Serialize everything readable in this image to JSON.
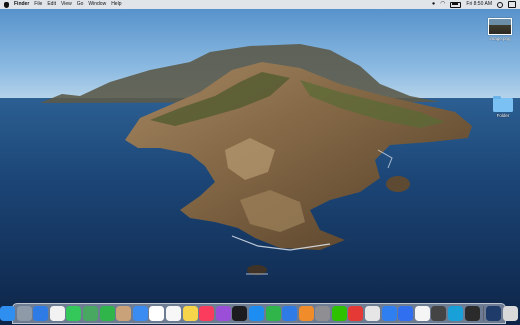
{
  "menubar": {
    "app_name": "Finder",
    "menus": [
      "File",
      "Edit",
      "View",
      "Go",
      "Window",
      "Help"
    ],
    "clock": "Fri 8:50 AM",
    "status_icons": [
      "siri-icon",
      "wifi-icon",
      "battery-icon",
      "search-icon",
      "control-center-icon"
    ]
  },
  "desktop": {
    "wallpaper": "macOS Catalina island",
    "icons": [
      {
        "name": "screenshot-file",
        "label": "image.png",
        "kind": "image"
      },
      {
        "name": "folder",
        "label": "Folder",
        "kind": "folder"
      }
    ]
  },
  "dock": {
    "apps": [
      {
        "name": "finder",
        "color": "#2f8ff0"
      },
      {
        "name": "launchpad",
        "color": "#8f9aa8"
      },
      {
        "name": "safari",
        "color": "#2e7be6"
      },
      {
        "name": "photos",
        "color": "#f2f2f2"
      },
      {
        "name": "messages",
        "color": "#34c759"
      },
      {
        "name": "maps",
        "color": "#48a862"
      },
      {
        "name": "facetime",
        "color": "#2fb54a"
      },
      {
        "name": "contacts",
        "color": "#c9a27a"
      },
      {
        "name": "mail",
        "color": "#3b8cf2"
      },
      {
        "name": "calendar",
        "color": "#ffffff"
      },
      {
        "name": "reminders",
        "color": "#f7f7f7"
      },
      {
        "name": "notes",
        "color": "#f7d54a"
      },
      {
        "name": "music",
        "color": "#fb3c5c"
      },
      {
        "name": "podcasts",
        "color": "#9b4fd8"
      },
      {
        "name": "apple-tv",
        "color": "#1c1c1e"
      },
      {
        "name": "app-store",
        "color": "#1d8df2"
      },
      {
        "name": "numbers",
        "color": "#2fb54a"
      },
      {
        "name": "keynote",
        "color": "#2e7be6"
      },
      {
        "name": "pages",
        "color": "#f08c2a"
      },
      {
        "name": "system-preferences",
        "color": "#8e8e93"
      },
      {
        "name": "wechat",
        "color": "#2dc100"
      },
      {
        "name": "wps",
        "color": "#e53935"
      },
      {
        "name": "xmind",
        "color": "#e6e6e6"
      },
      {
        "name": "baidu-netdisk",
        "color": "#2f7ff0"
      },
      {
        "name": "feishu",
        "color": "#2f6ff0"
      },
      {
        "name": "qq",
        "color": "#f5f5f5"
      },
      {
        "name": "pictures",
        "color": "#444444"
      },
      {
        "name": "edge",
        "color": "#1aa0d8"
      },
      {
        "name": "terminal",
        "color": "#2b2b2b"
      },
      {
        "name": "screenshot-preview",
        "color": "#1f3b6a"
      },
      {
        "name": "trash",
        "color": "#d9d9d9"
      }
    ]
  },
  "colors": {
    "sky": "#5f99cf",
    "ocean": "#163a6a",
    "island": "#8a6a43"
  }
}
